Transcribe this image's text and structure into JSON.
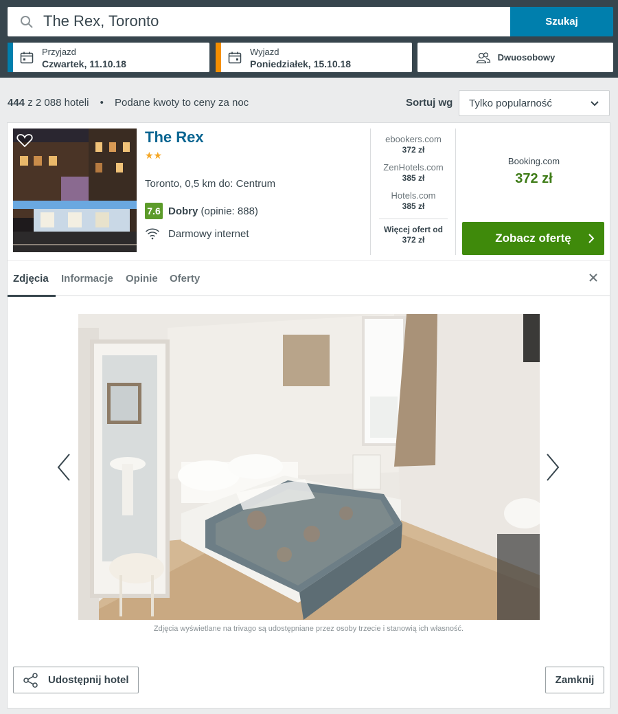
{
  "search": {
    "value": "The Rex, Toronto",
    "button_label": "Szukaj"
  },
  "checkin": {
    "label": "Przyjazd",
    "value": "Czwartek, 11.10.18",
    "accent": "#007fad"
  },
  "checkout": {
    "label": "Wyjazd",
    "value": "Poniedziałek, 15.10.18",
    "accent": "#f48f00"
  },
  "room": {
    "label": "Dwuosobowy"
  },
  "results": {
    "count": "444",
    "of_total": "z 2 088 hoteli",
    "note": "Podane kwoty to ceny za noc"
  },
  "sort": {
    "label": "Sortuj wg",
    "selected": "Tylko popularność"
  },
  "hotel": {
    "name": "The Rex",
    "stars": "★★",
    "location": "Toronto, 0,5 km do: Centrum",
    "rating_score": "7.6",
    "rating_word": "Dobry",
    "rating_reviews": "(opinie: 888)",
    "amenity": "Darmowy internet"
  },
  "offers": [
    {
      "site": "ebookers.com",
      "price": "372 zł"
    },
    {
      "site": "ZenHotels.com",
      "price": "385 zł"
    },
    {
      "site": "Hotels.com",
      "price": "385 zł"
    }
  ],
  "more_offers": {
    "label": "Więcej ofert od",
    "price": "372 zł"
  },
  "best_offer": {
    "site": "Booking.com",
    "price": "372 zł",
    "button_label": "Zobacz ofertę"
  },
  "tabs": [
    {
      "label": "Zdjęcia"
    },
    {
      "label": "Informacje"
    },
    {
      "label": "Opinie"
    },
    {
      "label": "Oferty"
    }
  ],
  "gallery": {
    "credit": "Zdjęcia wyświetlane na trivago są udostępniane przez osoby trzecie i stanowią ich własność."
  },
  "footer": {
    "share_label": "Udostępnij hotel",
    "close_label": "Zamknij"
  }
}
